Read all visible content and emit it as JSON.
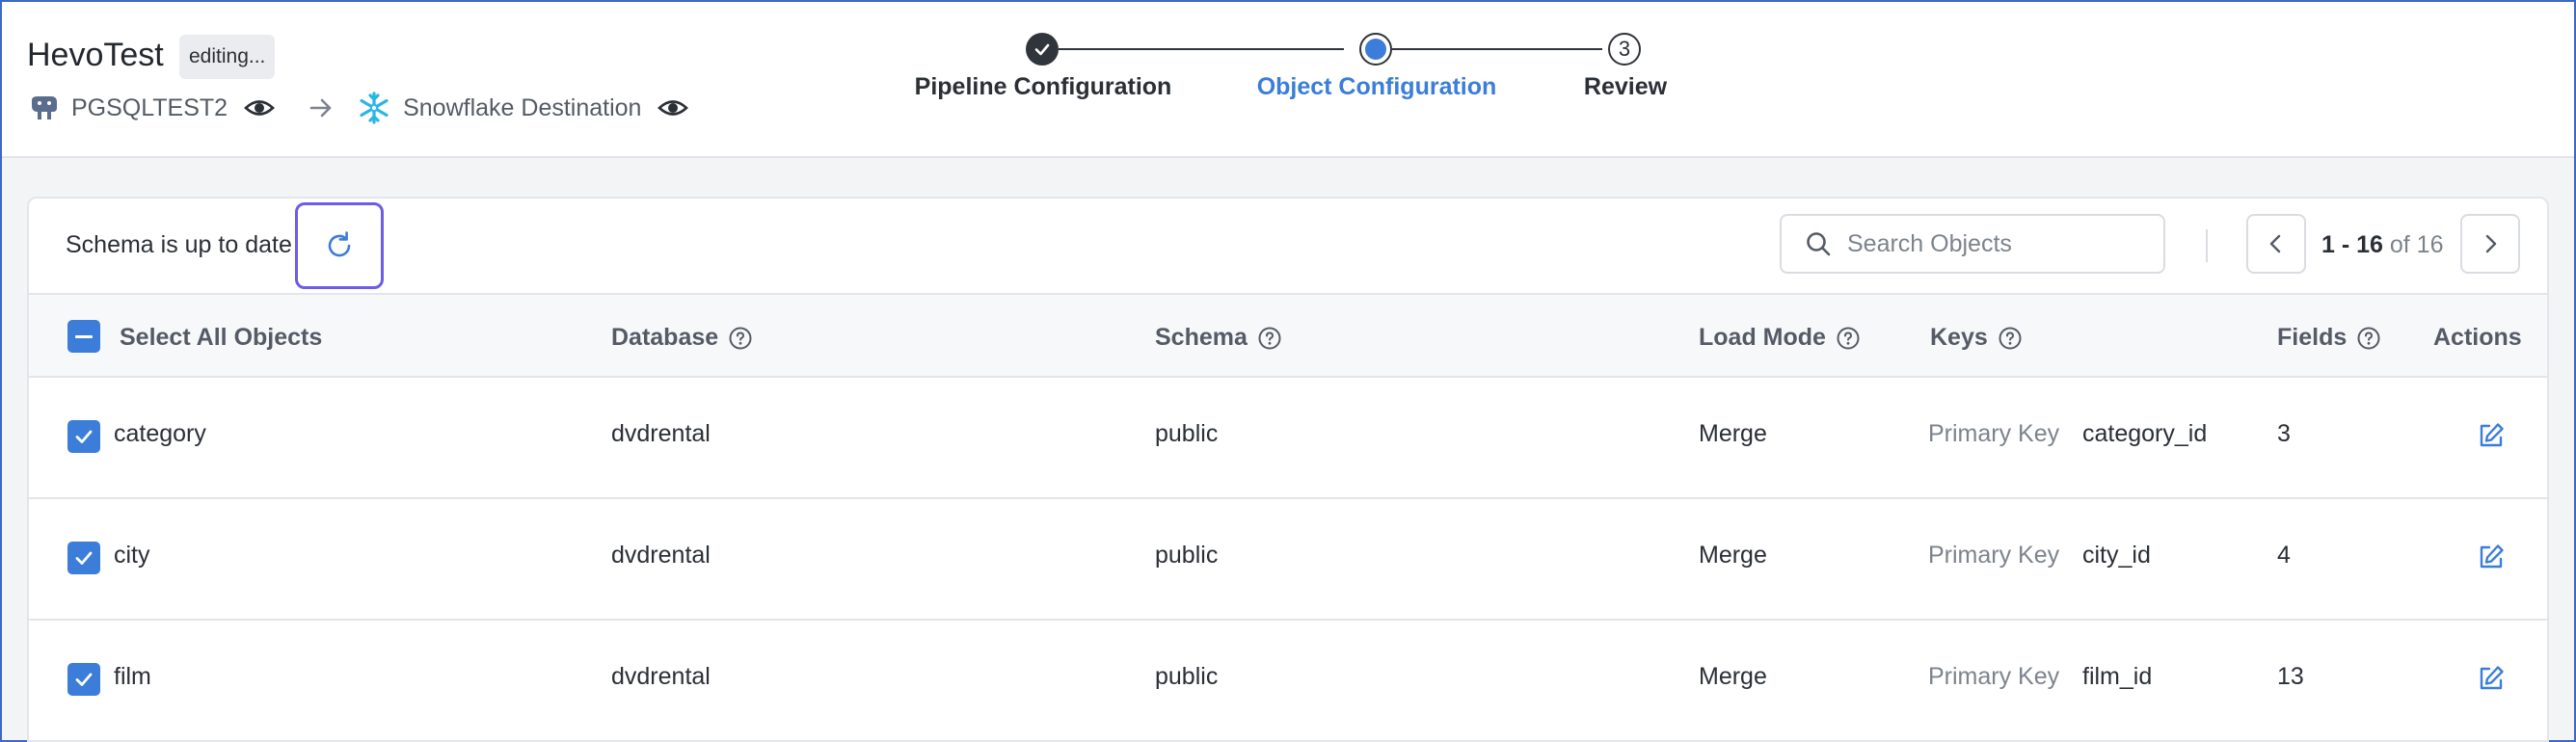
{
  "header": {
    "pipeline_name": "HevoTest",
    "status_badge": "editing...",
    "source": {
      "name": "PGSQLTEST2",
      "icon": "postgres-elephant-icon"
    },
    "destination": {
      "name": "Snowflake Destination",
      "icon": "snowflake-icon"
    }
  },
  "stepper": {
    "steps": [
      {
        "label": "Pipeline Configuration",
        "state": "done"
      },
      {
        "label": "Object Configuration",
        "state": "active"
      },
      {
        "label": "Review",
        "state": "pending",
        "number": "3"
      }
    ]
  },
  "toolbar": {
    "schema_status": "Schema is up to date",
    "search_placeholder": "Search Objects",
    "search_value": ""
  },
  "pagination": {
    "range": "1 - 16",
    "of_label": "of 16"
  },
  "table": {
    "columns": {
      "select_all": "Select All Objects",
      "database": "Database",
      "schema": "Schema",
      "load_mode": "Load Mode",
      "keys": "Keys",
      "fields": "Fields",
      "actions": "Actions"
    },
    "rows": [
      {
        "name": "category",
        "database": "dvdrental",
        "schema": "public",
        "load_mode": "Merge",
        "key_type": "Primary Key",
        "key": "category_id",
        "fields": "3"
      },
      {
        "name": "city",
        "database": "dvdrental",
        "schema": "public",
        "load_mode": "Merge",
        "key_type": "Primary Key",
        "key": "city_id",
        "fields": "4"
      },
      {
        "name": "film",
        "database": "dvdrental",
        "schema": "public",
        "load_mode": "Merge",
        "key_type": "Primary Key",
        "key": "film_id",
        "fields": "13"
      }
    ]
  },
  "colors": {
    "accent": "#3b7dd8",
    "focus_ring": "#6c5ce7",
    "text": "#2b2f36",
    "muted": "#7d838d",
    "snowflake": "#29b5e8"
  }
}
